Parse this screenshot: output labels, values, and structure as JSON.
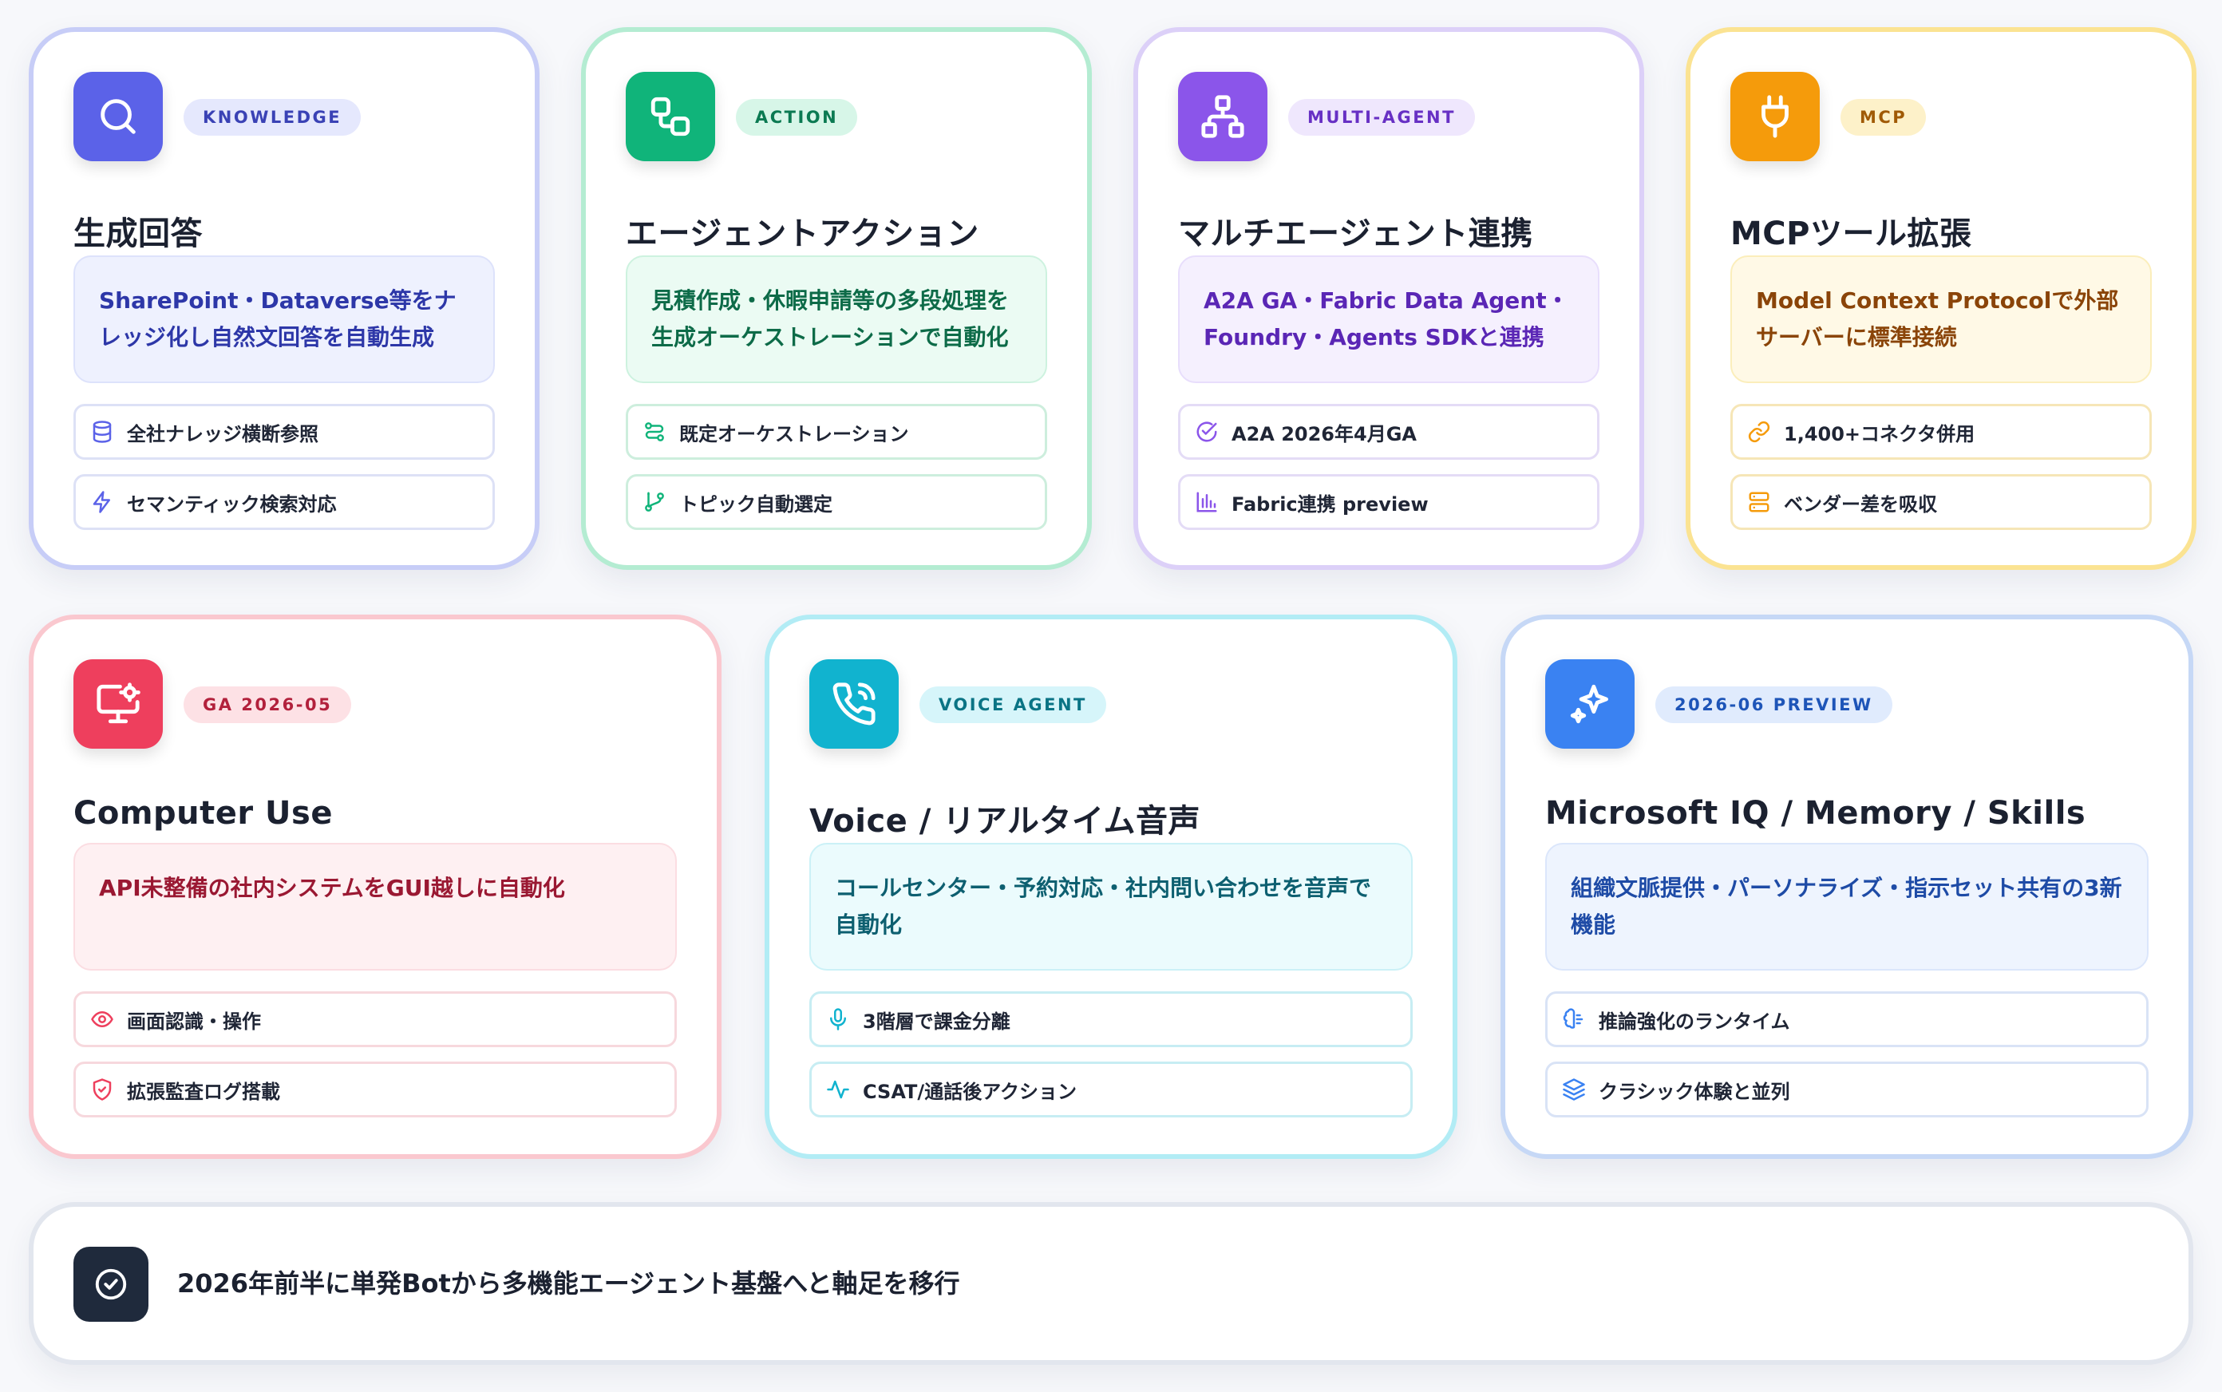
{
  "cards": [
    {
      "badge": "KNOWLEDGE",
      "title": "生成回答",
      "desc": "SharePoint・Dataverse等をナレッジ化し自然文回答を自動生成",
      "features": [
        "全社ナレッジ横断参照",
        "セマンティック検索対応"
      ],
      "icon": "search-icon",
      "feature_icons": [
        "database-icon",
        "lightning-icon"
      ]
    },
    {
      "badge": "ACTION",
      "title": "エージェントアクション",
      "desc": "見積作成・休暇申請等の多段処理を生成オーケストレーションで自動化",
      "features": [
        "既定オーケストレーション",
        "トピック自動選定"
      ],
      "icon": "workflow-icon",
      "feature_icons": [
        "route-icon",
        "git-branch-icon"
      ]
    },
    {
      "badge": "MULTI-AGENT",
      "title": "マルチエージェント連携",
      "desc": "A2A GA・Fabric Data Agent・Foundry・Agents SDKと連携",
      "features": [
        "A2A 2026年4月GA",
        "Fabric連携 preview"
      ],
      "icon": "network-icon",
      "feature_icons": [
        "check-circle-icon",
        "bar-chart-icon"
      ]
    },
    {
      "badge": "MCP",
      "title": "MCPツール拡張",
      "desc": "Model Context Protocolで外部サーバーに標準接続",
      "features": [
        "1,400+コネクタ併用",
        "ベンダー差を吸収"
      ],
      "icon": "plug-icon",
      "feature_icons": [
        "link-icon",
        "server-icon"
      ]
    },
    {
      "badge": "GA 2026-05",
      "title": "Computer Use",
      "desc": "API未整備の社内システムをGUI越しに自動化",
      "features": [
        "画面認識・操作",
        "拡張監査ログ搭載"
      ],
      "icon": "monitor-cog-icon",
      "feature_icons": [
        "eye-icon",
        "shield-icon"
      ]
    },
    {
      "badge": "VOICE AGENT",
      "title": "Voice / リアルタイム音声",
      "desc": "コールセンター・予約対応・社内問い合わせを音声で自動化",
      "features": [
        "3階層で課金分離",
        "CSAT/通話後アクション"
      ],
      "icon": "phone-call-icon",
      "feature_icons": [
        "mic-icon",
        "activity-icon"
      ]
    },
    {
      "badge": "2026-06 PREVIEW",
      "title": "Microsoft IQ / Memory / Skills",
      "desc": "組織文脈提供・パーソナライズ・指示セット共有の3新機能",
      "features": [
        "推論強化のランタイム",
        "クラシック体験と並列"
      ],
      "icon": "sparkles-icon",
      "feature_icons": [
        "brain-icon",
        "layers-icon"
      ]
    }
  ],
  "footer": {
    "text": "2026年前半に単発Botから多機能エージェント基盤へと軸足を移行",
    "icon": "check-circle-icon"
  },
  "colors": {
    "knowledge": "#5b62e8",
    "action": "#10b47a",
    "multi_agent": "#8b55ea",
    "mcp": "#f59b0b",
    "computer_use": "#ee3f5d",
    "voice": "#11b3cf",
    "microsoft_iq": "#3a82f2",
    "footer_icon_bg": "#1f2a3c"
  }
}
